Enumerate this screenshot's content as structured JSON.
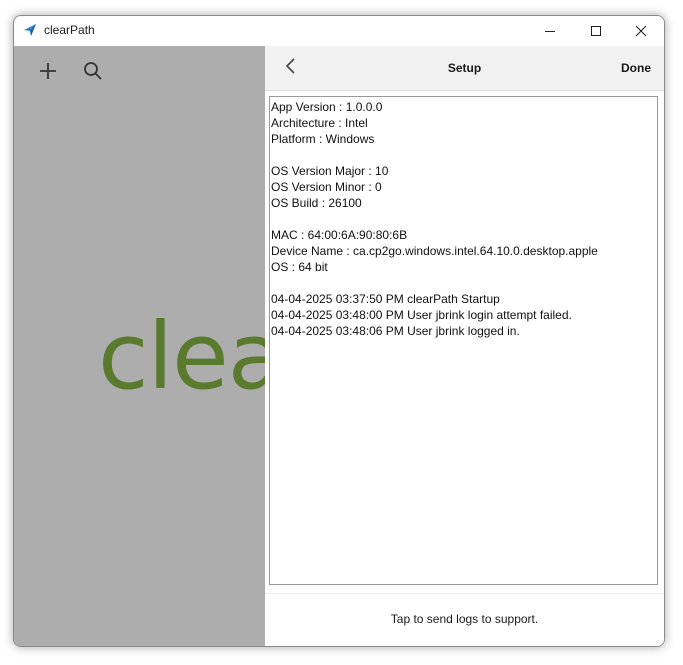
{
  "window": {
    "title": "clearPath",
    "icon": "app-logo-icon",
    "controls": [
      "minimize-icon",
      "maximize-icon",
      "close-icon"
    ]
  },
  "left_pane": {
    "toolbar_icons": [
      "add-icon",
      "search-icon"
    ],
    "logo_text": "clear",
    "logo_color": "#5a7a2e",
    "background_color": "#adadad"
  },
  "setup": {
    "back_icon": "chevron-left-icon",
    "title": "Setup",
    "done_label": "Done",
    "log_lines": [
      "App Version : 1.0.0.0",
      "Architecture : Intel",
      "Platform : Windows",
      "",
      "OS Version Major : 10",
      "OS Version Minor : 0",
      "OS Build : 26100",
      "",
      "MAC : 64:00:6A:90:80:6B",
      "Device Name : ca.cp2go.windows.intel.64.10.0.desktop.apple",
      "OS : 64 bit",
      "",
      "04-04-2025 03:37:50 PM clearPath Startup",
      "04-04-2025 03:48:00 PM User jbrink login attempt failed.",
      "04-04-2025 03:48:06 PM User jbrink logged in."
    ],
    "send_logs_label": "Tap to send logs to support."
  }
}
